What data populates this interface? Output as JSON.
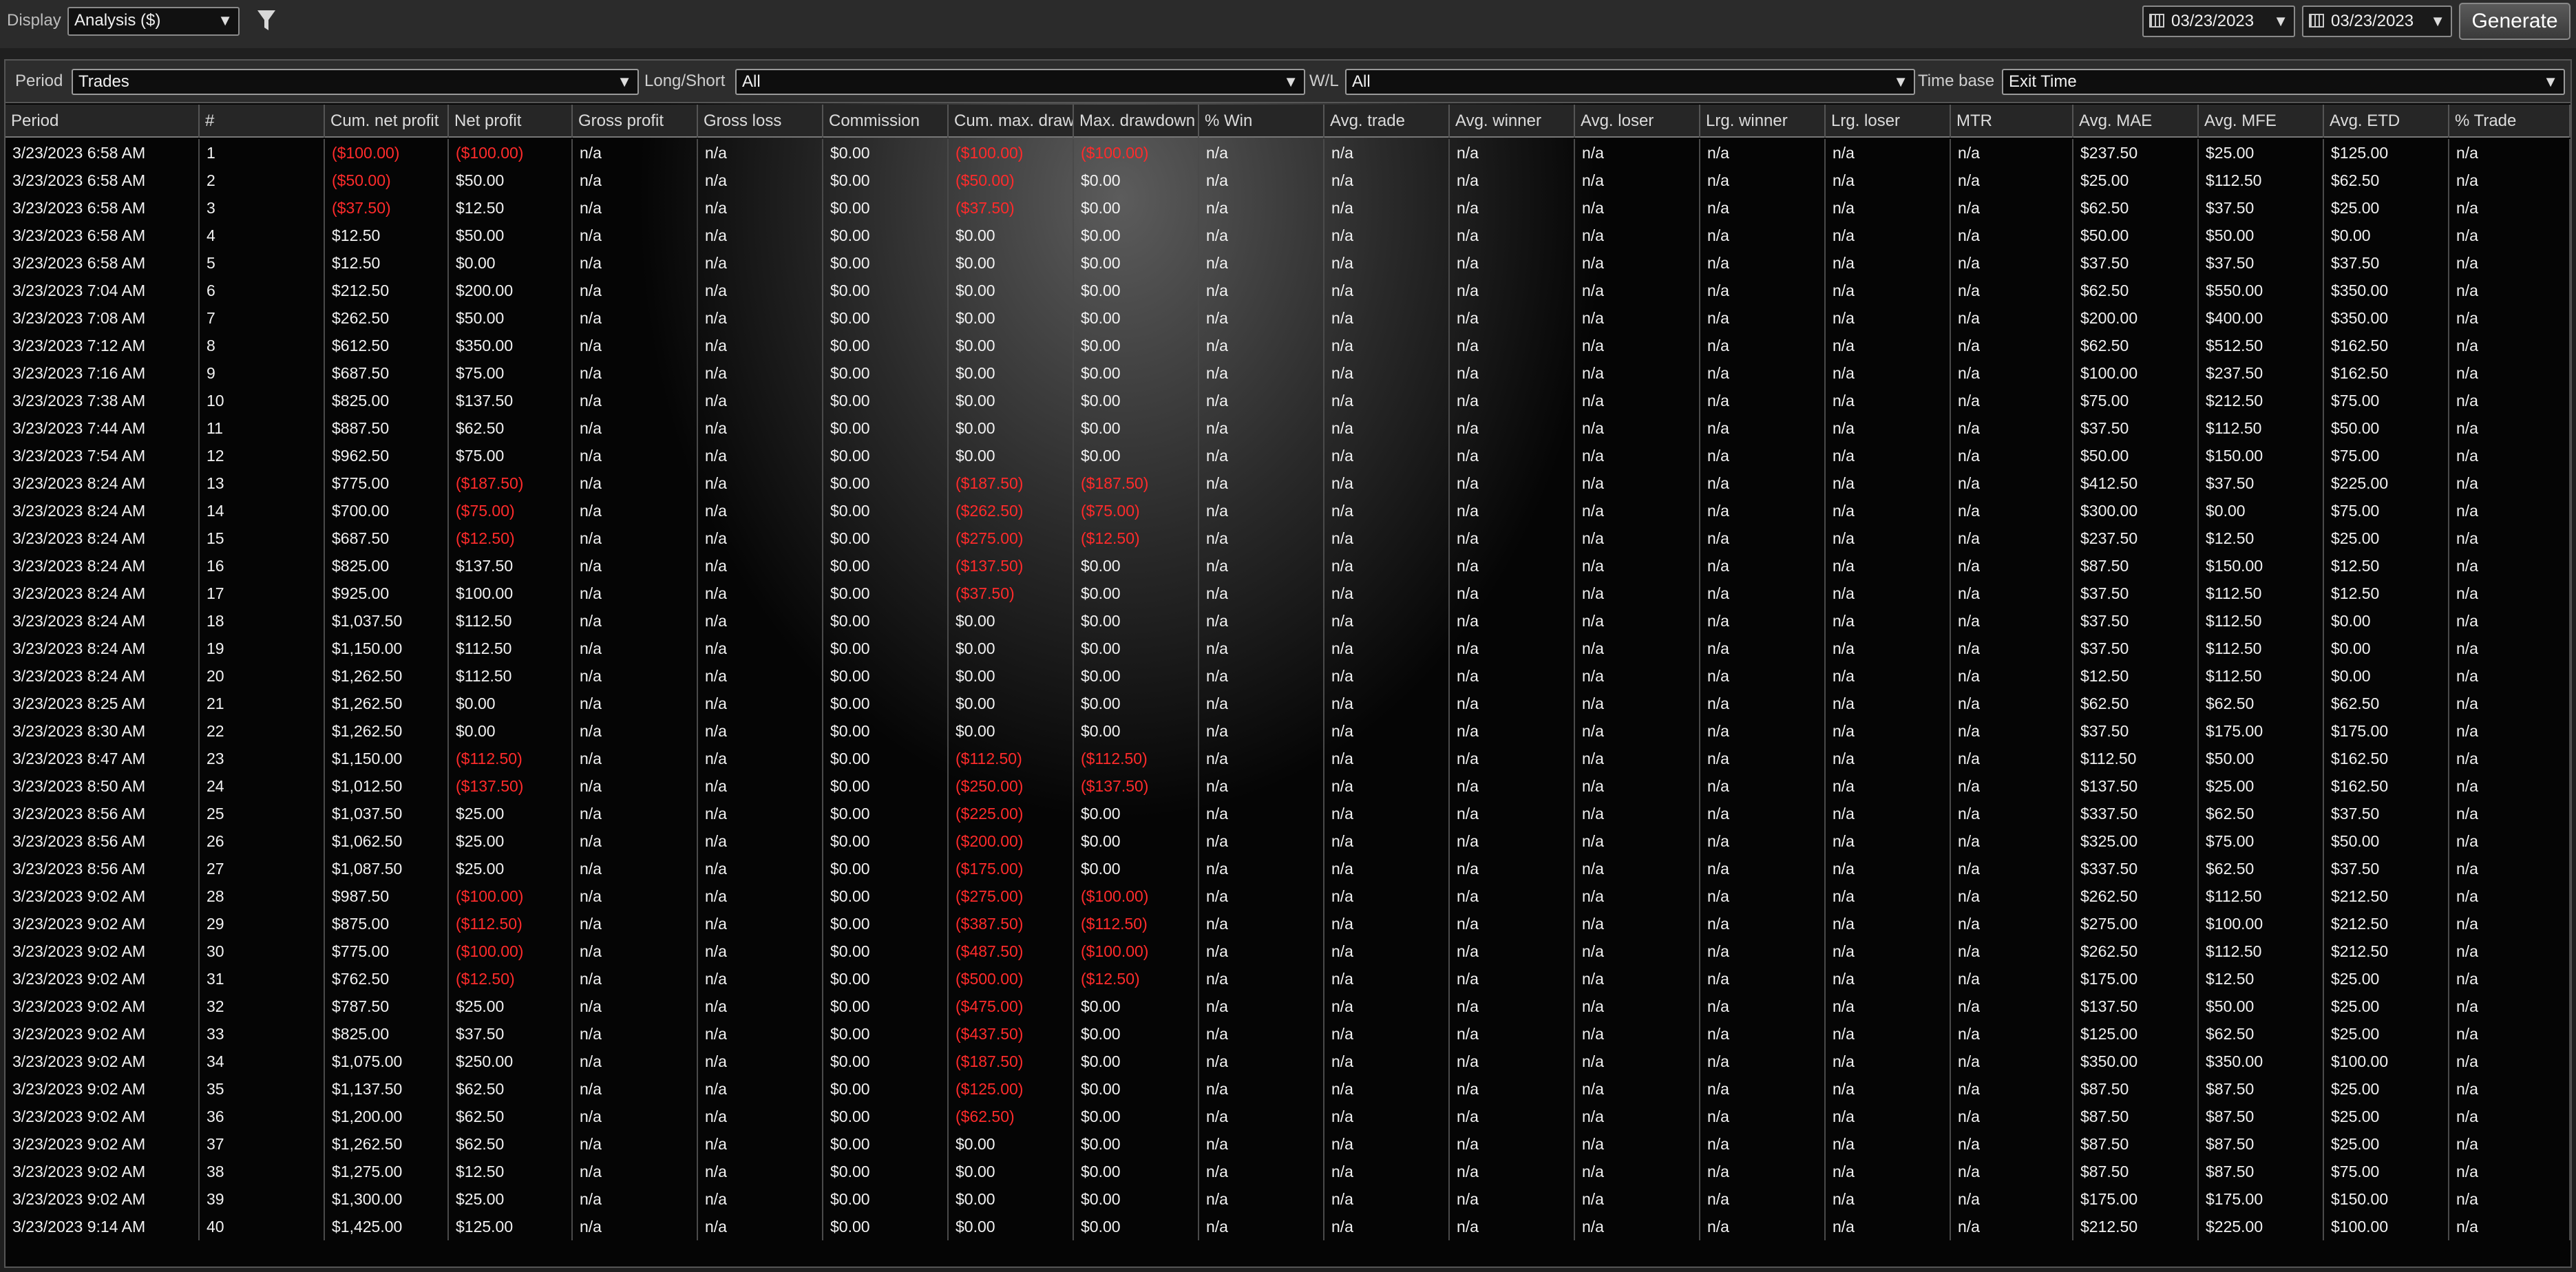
{
  "toolbar": {
    "display_label": "Display",
    "display_value": "Analysis ($)",
    "date_from": "03/23/2023",
    "date_to": "03/23/2023",
    "generate_label": "Generate"
  },
  "filters": {
    "period_label": "Period",
    "period_value": "Trades",
    "long_short_label": "Long/Short",
    "long_short_value": "All",
    "wl_label": "W/L",
    "wl_value": "All",
    "time_base_label": "Time base",
    "time_base_value": "Exit Time"
  },
  "columns": [
    "Period",
    "#",
    "Cum. net profit",
    "Net profit",
    "Gross profit",
    "Gross loss",
    "Commission",
    "Cum. max. drawdown",
    "Max. drawdown",
    "% Win",
    "Avg. trade",
    "Avg. winner",
    "Avg. loser",
    "Lrg. winner",
    "Lrg. loser",
    "MTR",
    "Avg. MAE",
    "Avg. MFE",
    "Avg. ETD",
    "% Trade"
  ],
  "colors": {
    "negative": "#ff2b2b",
    "text": "#f2f2f2",
    "background": "#1f1f1f"
  },
  "rows": [
    [
      "3/23/2023 6:58 AM",
      "1",
      "($100.00)",
      "($100.00)",
      "n/a",
      "n/a",
      "$0.00",
      "($100.00)",
      "($100.00)",
      "n/a",
      "n/a",
      "n/a",
      "n/a",
      "n/a",
      "n/a",
      "n/a",
      "$237.50",
      "$25.00",
      "$125.00",
      "n/a"
    ],
    [
      "3/23/2023 6:58 AM",
      "2",
      "($50.00)",
      "$50.00",
      "n/a",
      "n/a",
      "$0.00",
      "($50.00)",
      "$0.00",
      "n/a",
      "n/a",
      "n/a",
      "n/a",
      "n/a",
      "n/a",
      "n/a",
      "$25.00",
      "$112.50",
      "$62.50",
      "n/a"
    ],
    [
      "3/23/2023 6:58 AM",
      "3",
      "($37.50)",
      "$12.50",
      "n/a",
      "n/a",
      "$0.00",
      "($37.50)",
      "$0.00",
      "n/a",
      "n/a",
      "n/a",
      "n/a",
      "n/a",
      "n/a",
      "n/a",
      "$62.50",
      "$37.50",
      "$25.00",
      "n/a"
    ],
    [
      "3/23/2023 6:58 AM",
      "4",
      "$12.50",
      "$50.00",
      "n/a",
      "n/a",
      "$0.00",
      "$0.00",
      "$0.00",
      "n/a",
      "n/a",
      "n/a",
      "n/a",
      "n/a",
      "n/a",
      "n/a",
      "$50.00",
      "$50.00",
      "$0.00",
      "n/a"
    ],
    [
      "3/23/2023 6:58 AM",
      "5",
      "$12.50",
      "$0.00",
      "n/a",
      "n/a",
      "$0.00",
      "$0.00",
      "$0.00",
      "n/a",
      "n/a",
      "n/a",
      "n/a",
      "n/a",
      "n/a",
      "n/a",
      "$37.50",
      "$37.50",
      "$37.50",
      "n/a"
    ],
    [
      "3/23/2023 7:04 AM",
      "6",
      "$212.50",
      "$200.00",
      "n/a",
      "n/a",
      "$0.00",
      "$0.00",
      "$0.00",
      "n/a",
      "n/a",
      "n/a",
      "n/a",
      "n/a",
      "n/a",
      "n/a",
      "$62.50",
      "$550.00",
      "$350.00",
      "n/a"
    ],
    [
      "3/23/2023 7:08 AM",
      "7",
      "$262.50",
      "$50.00",
      "n/a",
      "n/a",
      "$0.00",
      "$0.00",
      "$0.00",
      "n/a",
      "n/a",
      "n/a",
      "n/a",
      "n/a",
      "n/a",
      "n/a",
      "$200.00",
      "$400.00",
      "$350.00",
      "n/a"
    ],
    [
      "3/23/2023 7:12 AM",
      "8",
      "$612.50",
      "$350.00",
      "n/a",
      "n/a",
      "$0.00",
      "$0.00",
      "$0.00",
      "n/a",
      "n/a",
      "n/a",
      "n/a",
      "n/a",
      "n/a",
      "n/a",
      "$62.50",
      "$512.50",
      "$162.50",
      "n/a"
    ],
    [
      "3/23/2023 7:16 AM",
      "9",
      "$687.50",
      "$75.00",
      "n/a",
      "n/a",
      "$0.00",
      "$0.00",
      "$0.00",
      "n/a",
      "n/a",
      "n/a",
      "n/a",
      "n/a",
      "n/a",
      "n/a",
      "$100.00",
      "$237.50",
      "$162.50",
      "n/a"
    ],
    [
      "3/23/2023 7:38 AM",
      "10",
      "$825.00",
      "$137.50",
      "n/a",
      "n/a",
      "$0.00",
      "$0.00",
      "$0.00",
      "n/a",
      "n/a",
      "n/a",
      "n/a",
      "n/a",
      "n/a",
      "n/a",
      "$75.00",
      "$212.50",
      "$75.00",
      "n/a"
    ],
    [
      "3/23/2023 7:44 AM",
      "11",
      "$887.50",
      "$62.50",
      "n/a",
      "n/a",
      "$0.00",
      "$0.00",
      "$0.00",
      "n/a",
      "n/a",
      "n/a",
      "n/a",
      "n/a",
      "n/a",
      "n/a",
      "$37.50",
      "$112.50",
      "$50.00",
      "n/a"
    ],
    [
      "3/23/2023 7:54 AM",
      "12",
      "$962.50",
      "$75.00",
      "n/a",
      "n/a",
      "$0.00",
      "$0.00",
      "$0.00",
      "n/a",
      "n/a",
      "n/a",
      "n/a",
      "n/a",
      "n/a",
      "n/a",
      "$50.00",
      "$150.00",
      "$75.00",
      "n/a"
    ],
    [
      "3/23/2023 8:24 AM",
      "13",
      "$775.00",
      "($187.50)",
      "n/a",
      "n/a",
      "$0.00",
      "($187.50)",
      "($187.50)",
      "n/a",
      "n/a",
      "n/a",
      "n/a",
      "n/a",
      "n/a",
      "n/a",
      "$412.50",
      "$37.50",
      "$225.00",
      "n/a"
    ],
    [
      "3/23/2023 8:24 AM",
      "14",
      "$700.00",
      "($75.00)",
      "n/a",
      "n/a",
      "$0.00",
      "($262.50)",
      "($75.00)",
      "n/a",
      "n/a",
      "n/a",
      "n/a",
      "n/a",
      "n/a",
      "n/a",
      "$300.00",
      "$0.00",
      "$75.00",
      "n/a"
    ],
    [
      "3/23/2023 8:24 AM",
      "15",
      "$687.50",
      "($12.50)",
      "n/a",
      "n/a",
      "$0.00",
      "($275.00)",
      "($12.50)",
      "n/a",
      "n/a",
      "n/a",
      "n/a",
      "n/a",
      "n/a",
      "n/a",
      "$237.50",
      "$12.50",
      "$25.00",
      "n/a"
    ],
    [
      "3/23/2023 8:24 AM",
      "16",
      "$825.00",
      "$137.50",
      "n/a",
      "n/a",
      "$0.00",
      "($137.50)",
      "$0.00",
      "n/a",
      "n/a",
      "n/a",
      "n/a",
      "n/a",
      "n/a",
      "n/a",
      "$87.50",
      "$150.00",
      "$12.50",
      "n/a"
    ],
    [
      "3/23/2023 8:24 AM",
      "17",
      "$925.00",
      "$100.00",
      "n/a",
      "n/a",
      "$0.00",
      "($37.50)",
      "$0.00",
      "n/a",
      "n/a",
      "n/a",
      "n/a",
      "n/a",
      "n/a",
      "n/a",
      "$37.50",
      "$112.50",
      "$12.50",
      "n/a"
    ],
    [
      "3/23/2023 8:24 AM",
      "18",
      "$1,037.50",
      "$112.50",
      "n/a",
      "n/a",
      "$0.00",
      "$0.00",
      "$0.00",
      "n/a",
      "n/a",
      "n/a",
      "n/a",
      "n/a",
      "n/a",
      "n/a",
      "$37.50",
      "$112.50",
      "$0.00",
      "n/a"
    ],
    [
      "3/23/2023 8:24 AM",
      "19",
      "$1,150.00",
      "$112.50",
      "n/a",
      "n/a",
      "$0.00",
      "$0.00",
      "$0.00",
      "n/a",
      "n/a",
      "n/a",
      "n/a",
      "n/a",
      "n/a",
      "n/a",
      "$37.50",
      "$112.50",
      "$0.00",
      "n/a"
    ],
    [
      "3/23/2023 8:24 AM",
      "20",
      "$1,262.50",
      "$112.50",
      "n/a",
      "n/a",
      "$0.00",
      "$0.00",
      "$0.00",
      "n/a",
      "n/a",
      "n/a",
      "n/a",
      "n/a",
      "n/a",
      "n/a",
      "$12.50",
      "$112.50",
      "$0.00",
      "n/a"
    ],
    [
      "3/23/2023 8:25 AM",
      "21",
      "$1,262.50",
      "$0.00",
      "n/a",
      "n/a",
      "$0.00",
      "$0.00",
      "$0.00",
      "n/a",
      "n/a",
      "n/a",
      "n/a",
      "n/a",
      "n/a",
      "n/a",
      "$62.50",
      "$62.50",
      "$62.50",
      "n/a"
    ],
    [
      "3/23/2023 8:30 AM",
      "22",
      "$1,262.50",
      "$0.00",
      "n/a",
      "n/a",
      "$0.00",
      "$0.00",
      "$0.00",
      "n/a",
      "n/a",
      "n/a",
      "n/a",
      "n/a",
      "n/a",
      "n/a",
      "$37.50",
      "$175.00",
      "$175.00",
      "n/a"
    ],
    [
      "3/23/2023 8:47 AM",
      "23",
      "$1,150.00",
      "($112.50)",
      "n/a",
      "n/a",
      "$0.00",
      "($112.50)",
      "($112.50)",
      "n/a",
      "n/a",
      "n/a",
      "n/a",
      "n/a",
      "n/a",
      "n/a",
      "$112.50",
      "$50.00",
      "$162.50",
      "n/a"
    ],
    [
      "3/23/2023 8:50 AM",
      "24",
      "$1,012.50",
      "($137.50)",
      "n/a",
      "n/a",
      "$0.00",
      "($250.00)",
      "($137.50)",
      "n/a",
      "n/a",
      "n/a",
      "n/a",
      "n/a",
      "n/a",
      "n/a",
      "$137.50",
      "$25.00",
      "$162.50",
      "n/a"
    ],
    [
      "3/23/2023 8:56 AM",
      "25",
      "$1,037.50",
      "$25.00",
      "n/a",
      "n/a",
      "$0.00",
      "($225.00)",
      "$0.00",
      "n/a",
      "n/a",
      "n/a",
      "n/a",
      "n/a",
      "n/a",
      "n/a",
      "$337.50",
      "$62.50",
      "$37.50",
      "n/a"
    ],
    [
      "3/23/2023 8:56 AM",
      "26",
      "$1,062.50",
      "$25.00",
      "n/a",
      "n/a",
      "$0.00",
      "($200.00)",
      "$0.00",
      "n/a",
      "n/a",
      "n/a",
      "n/a",
      "n/a",
      "n/a",
      "n/a",
      "$325.00",
      "$75.00",
      "$50.00",
      "n/a"
    ],
    [
      "3/23/2023 8:56 AM",
      "27",
      "$1,087.50",
      "$25.00",
      "n/a",
      "n/a",
      "$0.00",
      "($175.00)",
      "$0.00",
      "n/a",
      "n/a",
      "n/a",
      "n/a",
      "n/a",
      "n/a",
      "n/a",
      "$337.50",
      "$62.50",
      "$37.50",
      "n/a"
    ],
    [
      "3/23/2023 9:02 AM",
      "28",
      "$987.50",
      "($100.00)",
      "n/a",
      "n/a",
      "$0.00",
      "($275.00)",
      "($100.00)",
      "n/a",
      "n/a",
      "n/a",
      "n/a",
      "n/a",
      "n/a",
      "n/a",
      "$262.50",
      "$112.50",
      "$212.50",
      "n/a"
    ],
    [
      "3/23/2023 9:02 AM",
      "29",
      "$875.00",
      "($112.50)",
      "n/a",
      "n/a",
      "$0.00",
      "($387.50)",
      "($112.50)",
      "n/a",
      "n/a",
      "n/a",
      "n/a",
      "n/a",
      "n/a",
      "n/a",
      "$275.00",
      "$100.00",
      "$212.50",
      "n/a"
    ],
    [
      "3/23/2023 9:02 AM",
      "30",
      "$775.00",
      "($100.00)",
      "n/a",
      "n/a",
      "$0.00",
      "($487.50)",
      "($100.00)",
      "n/a",
      "n/a",
      "n/a",
      "n/a",
      "n/a",
      "n/a",
      "n/a",
      "$262.50",
      "$112.50",
      "$212.50",
      "n/a"
    ],
    [
      "3/23/2023 9:02 AM",
      "31",
      "$762.50",
      "($12.50)",
      "n/a",
      "n/a",
      "$0.00",
      "($500.00)",
      "($12.50)",
      "n/a",
      "n/a",
      "n/a",
      "n/a",
      "n/a",
      "n/a",
      "n/a",
      "$175.00",
      "$12.50",
      "$25.00",
      "n/a"
    ],
    [
      "3/23/2023 9:02 AM",
      "32",
      "$787.50",
      "$25.00",
      "n/a",
      "n/a",
      "$0.00",
      "($475.00)",
      "$0.00",
      "n/a",
      "n/a",
      "n/a",
      "n/a",
      "n/a",
      "n/a",
      "n/a",
      "$137.50",
      "$50.00",
      "$25.00",
      "n/a"
    ],
    [
      "3/23/2023 9:02 AM",
      "33",
      "$825.00",
      "$37.50",
      "n/a",
      "n/a",
      "$0.00",
      "($437.50)",
      "$0.00",
      "n/a",
      "n/a",
      "n/a",
      "n/a",
      "n/a",
      "n/a",
      "n/a",
      "$125.00",
      "$62.50",
      "$25.00",
      "n/a"
    ],
    [
      "3/23/2023 9:02 AM",
      "34",
      "$1,075.00",
      "$250.00",
      "n/a",
      "n/a",
      "$0.00",
      "($187.50)",
      "$0.00",
      "n/a",
      "n/a",
      "n/a",
      "n/a",
      "n/a",
      "n/a",
      "n/a",
      "$350.00",
      "$350.00",
      "$100.00",
      "n/a"
    ],
    [
      "3/23/2023 9:02 AM",
      "35",
      "$1,137.50",
      "$62.50",
      "n/a",
      "n/a",
      "$0.00",
      "($125.00)",
      "$0.00",
      "n/a",
      "n/a",
      "n/a",
      "n/a",
      "n/a",
      "n/a",
      "n/a",
      "$87.50",
      "$87.50",
      "$25.00",
      "n/a"
    ],
    [
      "3/23/2023 9:02 AM",
      "36",
      "$1,200.00",
      "$62.50",
      "n/a",
      "n/a",
      "$0.00",
      "($62.50)",
      "$0.00",
      "n/a",
      "n/a",
      "n/a",
      "n/a",
      "n/a",
      "n/a",
      "n/a",
      "$87.50",
      "$87.50",
      "$25.00",
      "n/a"
    ],
    [
      "3/23/2023 9:02 AM",
      "37",
      "$1,262.50",
      "$62.50",
      "n/a",
      "n/a",
      "$0.00",
      "$0.00",
      "$0.00",
      "n/a",
      "n/a",
      "n/a",
      "n/a",
      "n/a",
      "n/a",
      "n/a",
      "$87.50",
      "$87.50",
      "$25.00",
      "n/a"
    ],
    [
      "3/23/2023 9:02 AM",
      "38",
      "$1,275.00",
      "$12.50",
      "n/a",
      "n/a",
      "$0.00",
      "$0.00",
      "$0.00",
      "n/a",
      "n/a",
      "n/a",
      "n/a",
      "n/a",
      "n/a",
      "n/a",
      "$87.50",
      "$87.50",
      "$75.00",
      "n/a"
    ],
    [
      "3/23/2023 9:02 AM",
      "39",
      "$1,300.00",
      "$25.00",
      "n/a",
      "n/a",
      "$0.00",
      "$0.00",
      "$0.00",
      "n/a",
      "n/a",
      "n/a",
      "n/a",
      "n/a",
      "n/a",
      "n/a",
      "$175.00",
      "$175.00",
      "$150.00",
      "n/a"
    ],
    [
      "3/23/2023 9:14 AM",
      "40",
      "$1,425.00",
      "$125.00",
      "n/a",
      "n/a",
      "$0.00",
      "$0.00",
      "$0.00",
      "n/a",
      "n/a",
      "n/a",
      "n/a",
      "n/a",
      "n/a",
      "n/a",
      "$212.50",
      "$225.00",
      "$100.00",
      "n/a"
    ]
  ]
}
